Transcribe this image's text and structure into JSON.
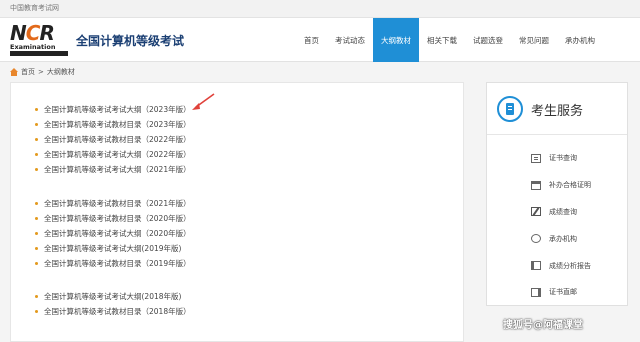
{
  "topbar": {
    "text": "中国教育考试网"
  },
  "header": {
    "logo": {
      "letters_n": "N",
      "letters_c": "C",
      "letters_r": "R",
      "word": "Examination"
    },
    "title": "全国计算机等级考试"
  },
  "nav": {
    "items": [
      "首页",
      "考试动态",
      "大纲教材",
      "相关下载",
      "试题选登",
      "常见问题",
      "承办机构"
    ],
    "active_index": 2
  },
  "breadcrumb": {
    "home": "首页",
    "separator": ">",
    "current": "大纲教材"
  },
  "content": {
    "group1": [
      "全国计算机等级考试考试大纲（2023年版）",
      "全国计算机等级考试教材目录（2023年版）",
      "全国计算机等级考试教材目录（2022年版）",
      "全国计算机等级考试考试大纲（2022年版）",
      "全国计算机等级考试考试大纲（2021年版）"
    ],
    "group2": [
      "全国计算机等级考试教材目录（2021年版）",
      "全国计算机等级考试教材目录（2020年版）",
      "全国计算机等级考试考试大纲（2020年版）",
      "全国计算机等级考试考试大纲(2019年版)",
      "全国计算机等级考试教材目录（2019年版）"
    ],
    "group3": [
      "全国计算机等级考试考试大纲(2018年版)",
      "全国计算机等级考试教材目录（2018年版）"
    ]
  },
  "sidebar": {
    "title": "考生服务",
    "items": [
      "证书查询",
      "补办合格证明",
      "成绩查询",
      "承办机构",
      "成绩分析报告",
      "证书直邮"
    ]
  },
  "watermark": "搜狐号@阿福课堂",
  "colors": {
    "accent": "#1f8fd6",
    "title_blue": "#1b3f73",
    "bullet": "#e39a1e",
    "arrow": "#e0413a"
  }
}
